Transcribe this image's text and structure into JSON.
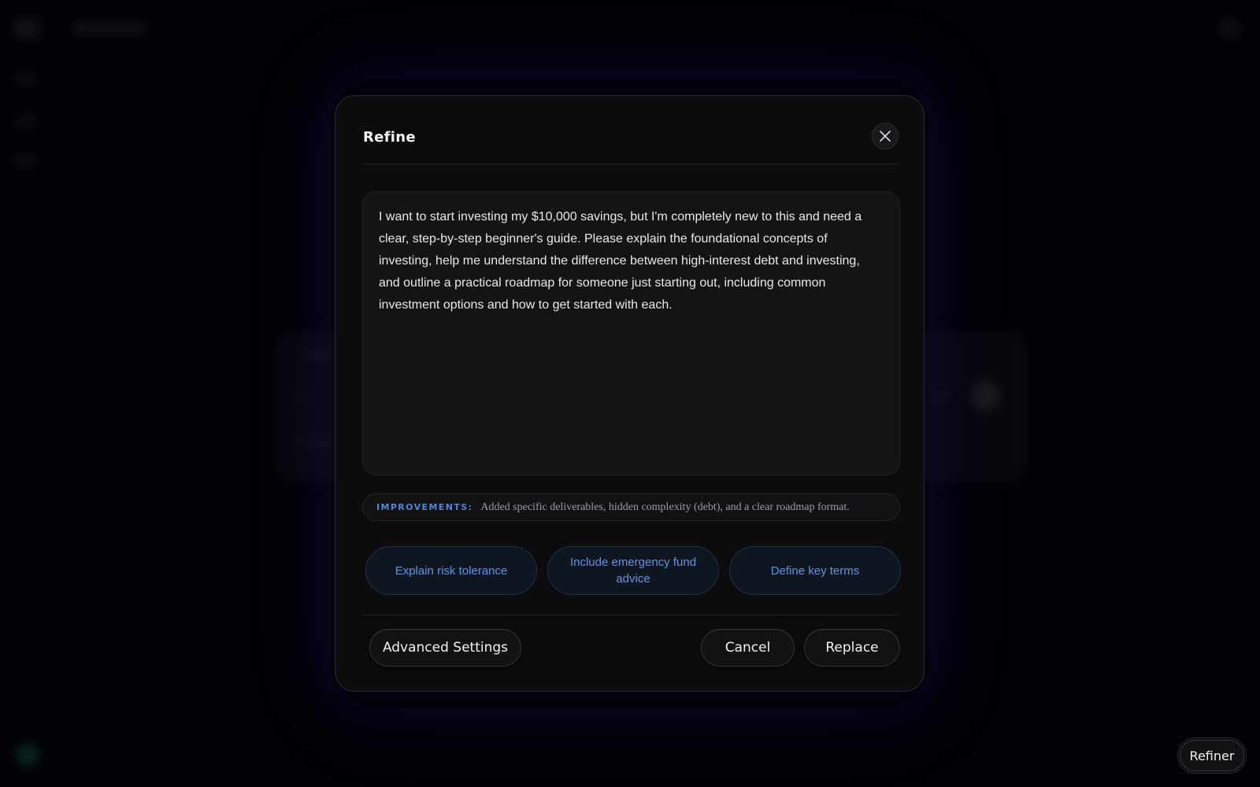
{
  "modal": {
    "title": "Refine",
    "prompt_text": "I want to start investing my $10,000 savings, but I'm completely new to this and need a clear, step-by-step beginner's guide. Please explain the foundational concepts of investing, help me understand the difference between high-interest debt and investing, and outline a practical roadmap for someone just starting out, including common investment options and how to get started with each.",
    "improvements": {
      "label": "IMPROVEMENTS:",
      "text": "Added specific deliverables, hidden complexity (debt), and a clear roadmap format."
    },
    "suggestions": [
      {
        "label": "Explain risk tolerance"
      },
      {
        "label": "Include emergency fund advice"
      },
      {
        "label": "Define key terms"
      }
    ],
    "footer": {
      "advanced_settings_label": "Advanced Settings",
      "cancel_label": "Cancel",
      "replace_label": "Replace"
    }
  },
  "refiner_button_label": "Refiner",
  "colors": {
    "accent_blue": "#5a95e6",
    "improvements_label": "#4f86d9",
    "modal_bg": "#0c0c0e",
    "page_bg": "#020205"
  },
  "icons": {
    "close": "close-icon"
  }
}
